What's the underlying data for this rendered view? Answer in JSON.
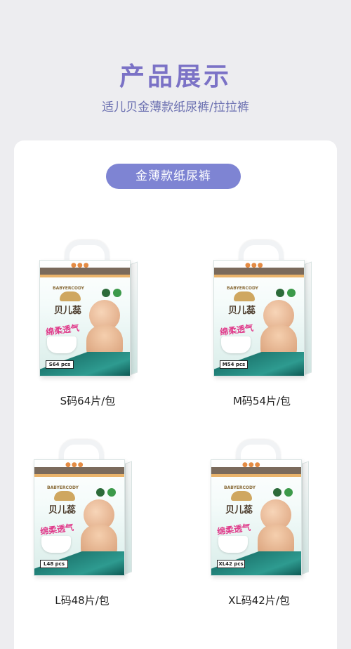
{
  "header": {
    "title": "产品展示",
    "subtitle": "适儿贝金薄款纸尿裤/拉拉裤"
  },
  "category": {
    "label": "金薄款纸尿裤"
  },
  "package": {
    "brand_small": "BABYERCODY",
    "logo_text": "贝儿蕊",
    "slogan": "绵柔透气"
  },
  "products": [
    {
      "label": "S码64片/包",
      "tag": "S64 pcs"
    },
    {
      "label": "M码54片/包",
      "tag": "M54 pcs"
    },
    {
      "label": "L码48片/包",
      "tag": "L48 pcs"
    },
    {
      "label": "XL码42片/包",
      "tag": "XL42 pcs"
    }
  ],
  "colors": {
    "accent": "#7b72c6",
    "pill": "#7e84d3",
    "background": "#ededf0"
  }
}
